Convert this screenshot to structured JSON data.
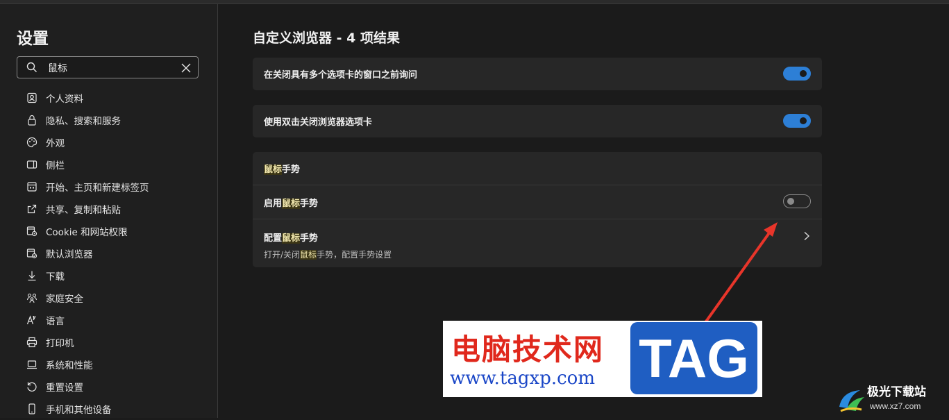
{
  "sidebar": {
    "title": "设置",
    "search": {
      "value": "鼠标"
    },
    "items": [
      {
        "label": "个人资料",
        "icon": "profile-icon"
      },
      {
        "label": "隐私、搜索和服务",
        "icon": "lock-icon"
      },
      {
        "label": "外观",
        "icon": "palette-icon"
      },
      {
        "label": "侧栏",
        "icon": "sidebar-icon"
      },
      {
        "label": "开始、主页和新建标签页",
        "icon": "home-page-icon"
      },
      {
        "label": "共享、复制和粘贴",
        "icon": "share-icon"
      },
      {
        "label": "Cookie 和网站权限",
        "icon": "site-permissions-icon"
      },
      {
        "label": "默认浏览器",
        "icon": "default-browser-icon"
      },
      {
        "label": "下载",
        "icon": "download-icon"
      },
      {
        "label": "家庭安全",
        "icon": "family-icon"
      },
      {
        "label": "语言",
        "icon": "language-icon"
      },
      {
        "label": "打印机",
        "icon": "printer-icon"
      },
      {
        "label": "系统和性能",
        "icon": "laptop-icon"
      },
      {
        "label": "重置设置",
        "icon": "reset-icon"
      },
      {
        "label": "手机和其他设备",
        "icon": "phone-icon"
      }
    ]
  },
  "main": {
    "title": "自定义浏览器 - 4 项结果",
    "setting_close_warning": {
      "label": "在关闭具有多个选项卡的窗口之前询问",
      "enabled": true
    },
    "setting_double_click": {
      "label": "使用双击关闭浏览器选项卡",
      "enabled": true
    },
    "mouse_gesture": {
      "heading_hl": "鼠标",
      "heading_rest": "手势",
      "enable_prefix": "启用",
      "enable_hl": "鼠标",
      "enable_suffix": "手势",
      "enable_on": false,
      "config_prefix": "配置",
      "config_hl": "鼠标",
      "config_suffix": "手势",
      "desc_prefix": "打开/关闭",
      "desc_hl": "鼠标",
      "desc_suffix": "手势，配置手势设置"
    }
  },
  "watermark": {
    "site_name": "电脑技术网",
    "url": "www.tagxp.com",
    "tag": "TAG"
  },
  "corner_logo": {
    "name": "极光下载站",
    "url": "www.xz7.com"
  },
  "colors": {
    "toggle_on": "#2d7fd6",
    "arrow": "#e8352a",
    "highlight": "#3b3515"
  }
}
